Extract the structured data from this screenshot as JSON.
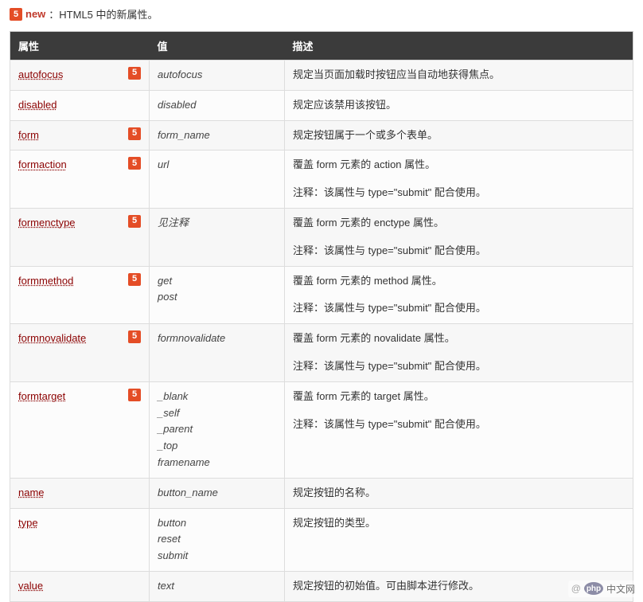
{
  "intro": {
    "icon_glyph": "5",
    "new_label": "new",
    "text": "：HTML5 中的新属性。"
  },
  "table": {
    "headers": {
      "attr": "属性",
      "value": "值",
      "desc": "描述"
    },
    "rows": [
      {
        "attr": "autofocus",
        "html5": true,
        "value": "autofocus",
        "desc": "规定当页面加载时按钮应当自动地获得焦点。",
        "note": ""
      },
      {
        "attr": "disabled",
        "html5": false,
        "value": "disabled",
        "desc": "规定应该禁用该按钮。",
        "note": ""
      },
      {
        "attr": "form",
        "html5": true,
        "value": "form_name",
        "desc": "规定按钮属于一个或多个表单。",
        "note": ""
      },
      {
        "attr": "formaction",
        "html5": true,
        "value": "url",
        "desc": "覆盖 form 元素的 action 属性。",
        "note": "注释：该属性与 type=\"submit\" 配合使用。"
      },
      {
        "attr": "formenctype",
        "html5": true,
        "value": "见注释",
        "desc": "覆盖 form 元素的 enctype 属性。",
        "note": "注释：该属性与 type=\"submit\" 配合使用。"
      },
      {
        "attr": "formmethod",
        "html5": true,
        "value": "get\npost",
        "desc": "覆盖 form 元素的 method 属性。",
        "note": "注释：该属性与 type=\"submit\" 配合使用。"
      },
      {
        "attr": "formnovalidate",
        "html5": true,
        "value": "formnovalidate",
        "desc": "覆盖 form 元素的 novalidate 属性。",
        "note": "注释：该属性与 type=\"submit\" 配合使用。"
      },
      {
        "attr": "formtarget",
        "html5": true,
        "value": "_blank\n_self\n_parent\n_top\nframename",
        "desc": "覆盖 form 元素的 target 属性。",
        "note": "注释：该属性与 type=\"submit\" 配合使用。"
      },
      {
        "attr": "name",
        "html5": false,
        "value": "button_name",
        "desc": "规定按钮的名称。",
        "note": ""
      },
      {
        "attr": "type",
        "html5": false,
        "value": "button\nreset\nsubmit",
        "desc": "规定按钮的类型。",
        "note": ""
      },
      {
        "attr": "value",
        "html5": false,
        "value": "text",
        "desc": "规定按钮的初始值。可由脚本进行修改。",
        "note": ""
      }
    ]
  },
  "footer": {
    "at": "@",
    "php": "php",
    "site": "中文网"
  },
  "icon_glyph": "5"
}
